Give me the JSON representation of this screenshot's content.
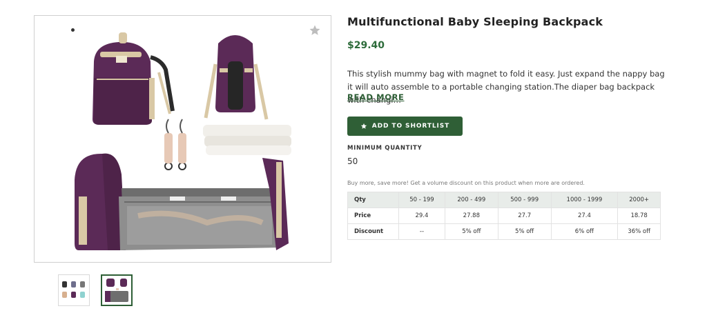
{
  "product": {
    "title": "Multifunctional Baby Sleeping Backpack",
    "price": "$29.40",
    "description": "This stylish mummy bag with magnet to fold it easy. Just expand the nappy bag it will auto assemble to a portable changing station.The diaper bag backpack with changi…",
    "read_more": "READ MORE"
  },
  "actions": {
    "shortlist_label": "ADD TO SHORTLIST"
  },
  "quantity": {
    "label": "MINIMUM QUANTITY",
    "value": "50"
  },
  "volume": {
    "note": "Buy more, save more! Get a volume discount on this product when more are ordered.",
    "headers": [
      "Qty",
      "50 - 199",
      "200 - 499",
      "500 - 999",
      "1000 - 1999",
      "2000+"
    ],
    "price_row": [
      "Price",
      "29.4",
      "27.88",
      "27.7",
      "27.4",
      "18.78"
    ],
    "discount_row": [
      "Discount",
      "--",
      "5% off",
      "5% off",
      "6% off",
      "36% off"
    ]
  },
  "gallery": {
    "thumbnail_count": 2,
    "selected_index": 1
  },
  "colors": {
    "brand": "#2f5f36",
    "price": "#2d6b3a",
    "bag": "#5b2a57"
  },
  "icons": {
    "favorite": "star-icon",
    "shortlist": "star-icon"
  }
}
